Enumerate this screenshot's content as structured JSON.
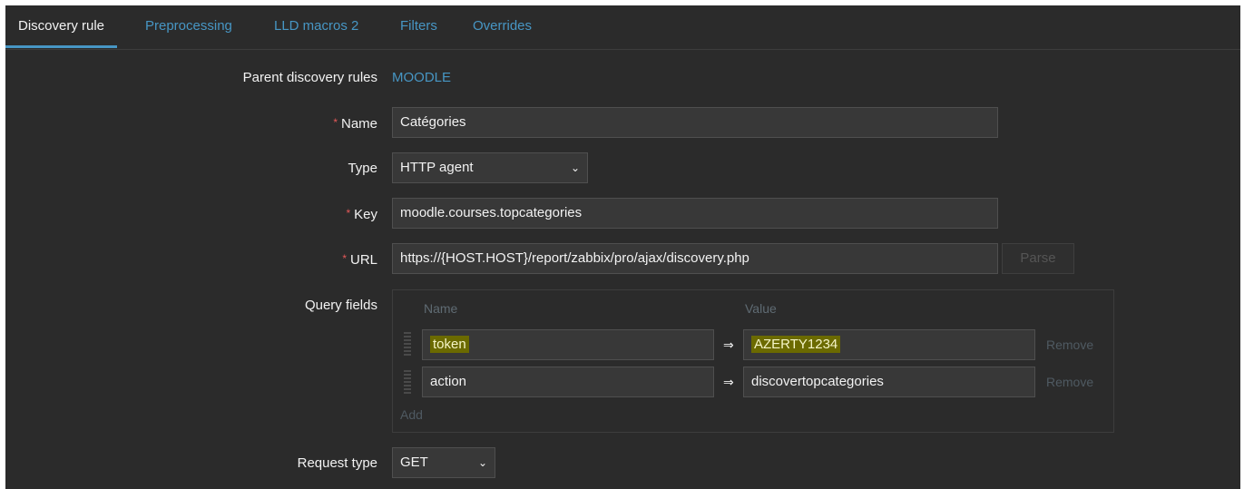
{
  "tabs": [
    {
      "label": "Discovery rule"
    },
    {
      "label": "Preprocessing"
    },
    {
      "label": "LLD macros 2"
    },
    {
      "label": "Filters"
    },
    {
      "label": "Overrides"
    }
  ],
  "form": {
    "parent_label": "Parent discovery rules",
    "parent_value": "MOODLE",
    "name_label": "Name",
    "name_value": "Catégories",
    "type_label": "Type",
    "type_value": "HTTP agent",
    "key_label": "Key",
    "key_value": "moodle.courses.topcategories",
    "url_label": "URL",
    "url_value": "https://{HOST.HOST}/report/zabbix/pro/ajax/discovery.php",
    "parse_label": "Parse",
    "query_label": "Query fields",
    "query": {
      "name_header": "Name",
      "value_header": "Value",
      "rows": [
        {
          "name": "token",
          "eq": "⇒",
          "value": "AZERTY1234",
          "remove": "Remove"
        },
        {
          "name": "action",
          "eq": "⇒",
          "value": "discovertopcategories",
          "remove": "Remove"
        }
      ],
      "add_label": "Add"
    },
    "request_type_label": "Request type",
    "request_type_value": "GET",
    "required_mark": "*",
    "chevron": "⌄"
  },
  "colors": {
    "background": "#2b2b2b",
    "link": "#4796c4",
    "required": "#e45959",
    "highlight": "#6b6a00"
  }
}
